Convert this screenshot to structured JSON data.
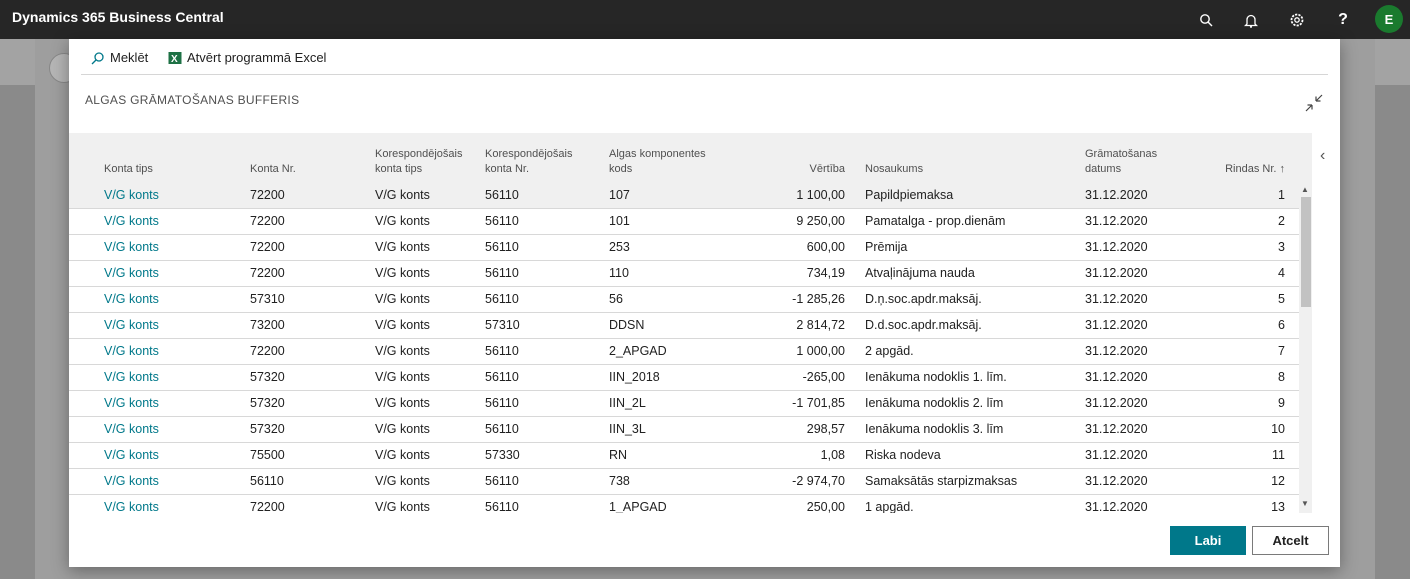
{
  "app": {
    "title": "Dynamics 365 Business Central",
    "avatar_initial": "E"
  },
  "topbar_icons": [
    "search-icon",
    "bell-icon",
    "gear-icon",
    "help-icon"
  ],
  "actions": {
    "search_label": "Meklēt",
    "excel_label": "Atvērt programmā Excel"
  },
  "dialog": {
    "title": "ALGAS GRĀMATOŠANAS BUFFERIS",
    "ok_label": "Labi",
    "cancel_label": "Atcelt"
  },
  "columns": [
    {
      "key": "konta_tips",
      "label": "Konta tips"
    },
    {
      "key": "konta_nr",
      "label": "Konta Nr."
    },
    {
      "key": "kor_tips",
      "label": "Korespondējošais konta tips"
    },
    {
      "key": "kor_nr",
      "label": "Korespondējošais konta Nr."
    },
    {
      "key": "kods",
      "label": "Algas komponentes kods"
    },
    {
      "key": "vertiba",
      "label": "Vērtība"
    },
    {
      "key": "nosaukums",
      "label": "Nosaukums"
    },
    {
      "key": "datums",
      "label": "Grāmatošanas datums"
    },
    {
      "key": "rindas_nr",
      "label": "Rindas Nr. ↑"
    }
  ],
  "rows": [
    [
      "V/G konts",
      "72200",
      "V/G konts",
      "56110",
      "107",
      "1 100,00",
      "Papildpiemaksa",
      "31.12.2020",
      "1"
    ],
    [
      "V/G konts",
      "72200",
      "V/G konts",
      "56110",
      "101",
      "9 250,00",
      "Pamatalga - prop.dienām",
      "31.12.2020",
      "2"
    ],
    [
      "V/G konts",
      "72200",
      "V/G konts",
      "56110",
      "253",
      "600,00",
      "Prēmija",
      "31.12.2020",
      "3"
    ],
    [
      "V/G konts",
      "72200",
      "V/G konts",
      "56110",
      "110",
      "734,19",
      "Atvaļinājuma nauda",
      "31.12.2020",
      "4"
    ],
    [
      "V/G konts",
      "57310",
      "V/G konts",
      "56110",
      "56",
      "-1 285,26",
      "D.ņ.soc.apdr.maksāj.",
      "31.12.2020",
      "5"
    ],
    [
      "V/G konts",
      "73200",
      "V/G konts",
      "57310",
      "DDSN",
      "2 814,72",
      "D.d.soc.apdr.maksāj.",
      "31.12.2020",
      "6"
    ],
    [
      "V/G konts",
      "72200",
      "V/G konts",
      "56110",
      "2_APGAD",
      "1 000,00",
      "2 apgād.",
      "31.12.2020",
      "7"
    ],
    [
      "V/G konts",
      "57320",
      "V/G konts",
      "56110",
      "IIN_2018",
      "-265,00",
      "Ienākuma nodoklis 1. līm.",
      "31.12.2020",
      "8"
    ],
    [
      "V/G konts",
      "57320",
      "V/G konts",
      "56110",
      "IIN_2L",
      "-1 701,85",
      "Ienākuma nodoklis 2. līm",
      "31.12.2020",
      "9"
    ],
    [
      "V/G konts",
      "57320",
      "V/G konts",
      "56110",
      "IIN_3L",
      "298,57",
      "Ienākuma nodoklis 3. līm",
      "31.12.2020",
      "10"
    ],
    [
      "V/G konts",
      "75500",
      "V/G konts",
      "57330",
      "RN",
      "1,08",
      "Riska nodeva",
      "31.12.2020",
      "11"
    ],
    [
      "V/G konts",
      "56110",
      "V/G konts",
      "56110",
      "738",
      "-2 974,70",
      "Samaksātās starpizmaksas",
      "31.12.2020",
      "12"
    ],
    [
      "V/G konts",
      "72200",
      "V/G konts",
      "56110",
      "1_APGAD",
      "250,00",
      "1 apgād.",
      "31.12.2020",
      "13"
    ]
  ]
}
